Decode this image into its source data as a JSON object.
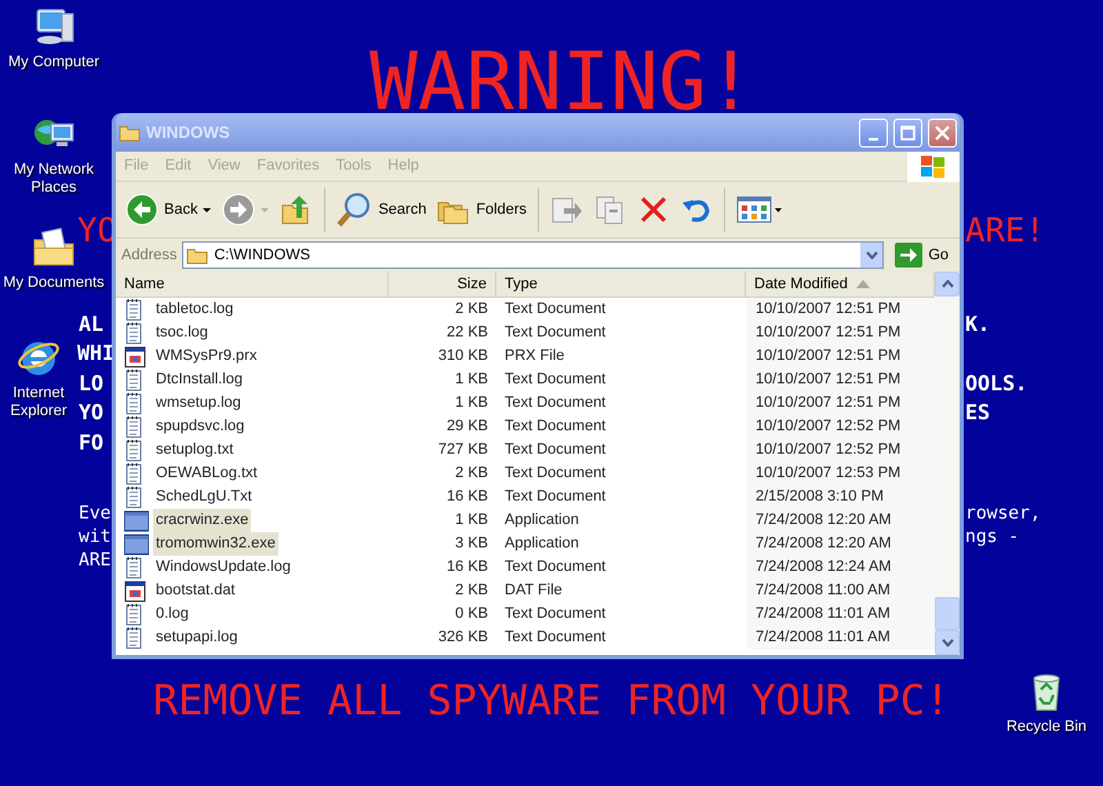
{
  "desktop": {
    "icons": [
      {
        "label": "My Computer",
        "kind": "computer"
      },
      {
        "label": "My Network Places",
        "kind": "network"
      },
      {
        "label": "My Documents",
        "kind": "documents"
      },
      {
        "label": "Internet Explorer",
        "kind": "browser"
      },
      {
        "label": "Recycle Bin",
        "kind": "recycle"
      }
    ],
    "warning_texts": [
      {
        "text": "WARNING!",
        "kind": "title"
      },
      {
        "text": "YO",
        "kind": "heading"
      },
      {
        "text": "ARE!",
        "kind": "heading"
      },
      {
        "text": "AL",
        "kind": "body"
      },
      {
        "text": "K.",
        "kind": "body"
      },
      {
        "text": "WHI",
        "kind": "body"
      },
      {
        "text": "LO",
        "kind": "body"
      },
      {
        "text": "OOLS.",
        "kind": "body"
      },
      {
        "text": "YO",
        "kind": "body"
      },
      {
        "text": "ES",
        "kind": "body"
      },
      {
        "text": "FO",
        "kind": "body"
      },
      {
        "text": "Eve",
        "kind": "small"
      },
      {
        "text": "rowser,",
        "kind": "small"
      },
      {
        "text": "wit",
        "kind": "small"
      },
      {
        "text": "ngs -",
        "kind": "small"
      },
      {
        "text": "ARE",
        "kind": "small"
      },
      {
        "text": "REMOVE ALL SPYWARE FROM YOUR PC!",
        "kind": "banner"
      }
    ]
  },
  "window": {
    "title": "WINDOWS",
    "menu": [
      "File",
      "Edit",
      "View",
      "Favorites",
      "Tools",
      "Help"
    ],
    "toolbar": [
      {
        "kind": "back",
        "label": "Back",
        "disabled": false
      },
      {
        "kind": "forward",
        "disabled": true
      },
      {
        "kind": "up",
        "disabled": false
      },
      {
        "kind": "search",
        "label": "Search",
        "disabled": false
      },
      {
        "kind": "folders",
        "label": "Folders",
        "disabled": false
      },
      {
        "kind": "moveto",
        "disabled": true
      },
      {
        "kind": "copyto",
        "disabled": true
      },
      {
        "kind": "delete",
        "disabled": false
      },
      {
        "kind": "undo",
        "disabled": false
      },
      {
        "kind": "views",
        "disabled": false
      }
    ],
    "address": {
      "label": "Address",
      "value": "C:\\WINDOWS",
      "go": "Go"
    },
    "table": {
      "columns": [
        {
          "label": "Name",
          "sorted": false
        },
        {
          "label": "Size",
          "sorted": false
        },
        {
          "label": "Type",
          "sorted": false
        },
        {
          "label": "Date Modified",
          "sorted": true
        }
      ],
      "rows": [
        {
          "kind": "text",
          "name": "tabletoc.log",
          "size": "2 KB",
          "type": "Text Document",
          "date": "10/10/2007 12:51 PM",
          "selected": false
        },
        {
          "kind": "text",
          "name": "tsoc.log",
          "size": "22 KB",
          "type": "Text Document",
          "date": "10/10/2007 12:51 PM",
          "selected": false
        },
        {
          "kind": "file",
          "name": "WMSysPr9.prx",
          "size": "310 KB",
          "type": "PRX File",
          "date": "10/10/2007 12:51 PM",
          "selected": false
        },
        {
          "kind": "text",
          "name": "DtcInstall.log",
          "size": "1 KB",
          "type": "Text Document",
          "date": "10/10/2007 12:51 PM",
          "selected": false
        },
        {
          "kind": "text",
          "name": "wmsetup.log",
          "size": "1 KB",
          "type": "Text Document",
          "date": "10/10/2007 12:51 PM",
          "selected": false
        },
        {
          "kind": "text",
          "name": "spupdsvc.log",
          "size": "29 KB",
          "type": "Text Document",
          "date": "10/10/2007 12:52 PM",
          "selected": false
        },
        {
          "kind": "text",
          "name": "setuplog.txt",
          "size": "727 KB",
          "type": "Text Document",
          "date": "10/10/2007 12:52 PM",
          "selected": false
        },
        {
          "kind": "text",
          "name": "OEWABLog.txt",
          "size": "2 KB",
          "type": "Text Document",
          "date": "10/10/2007 12:53 PM",
          "selected": false
        },
        {
          "kind": "text",
          "name": "SchedLgU.Txt",
          "size": "16 KB",
          "type": "Text Document",
          "date": "2/15/2008 3:10 PM",
          "selected": false
        },
        {
          "kind": "app",
          "name": "cracrwinz.exe",
          "size": "1 KB",
          "type": "Application",
          "date": "7/24/2008 12:20 AM",
          "selected": true
        },
        {
          "kind": "app",
          "name": "tromomwin32.exe",
          "size": "3 KB",
          "type": "Application",
          "date": "7/24/2008 12:20 AM",
          "selected": true
        },
        {
          "kind": "text",
          "name": "WindowsUpdate.log",
          "size": "16 KB",
          "type": "Text Document",
          "date": "7/24/2008 12:24 AM",
          "selected": false
        },
        {
          "kind": "file",
          "name": "bootstat.dat",
          "size": "2 KB",
          "type": "DAT File",
          "date": "7/24/2008 11:00 AM",
          "selected": false
        },
        {
          "kind": "text",
          "name": "0.log",
          "size": "0 KB",
          "type": "Text Document",
          "date": "7/24/2008 11:01 AM",
          "selected": false
        },
        {
          "kind": "text",
          "name": "setupapi.log",
          "size": "326 KB",
          "type": "Text Document",
          "date": "7/24/2008 11:01 AM",
          "selected": false
        }
      ]
    }
  }
}
